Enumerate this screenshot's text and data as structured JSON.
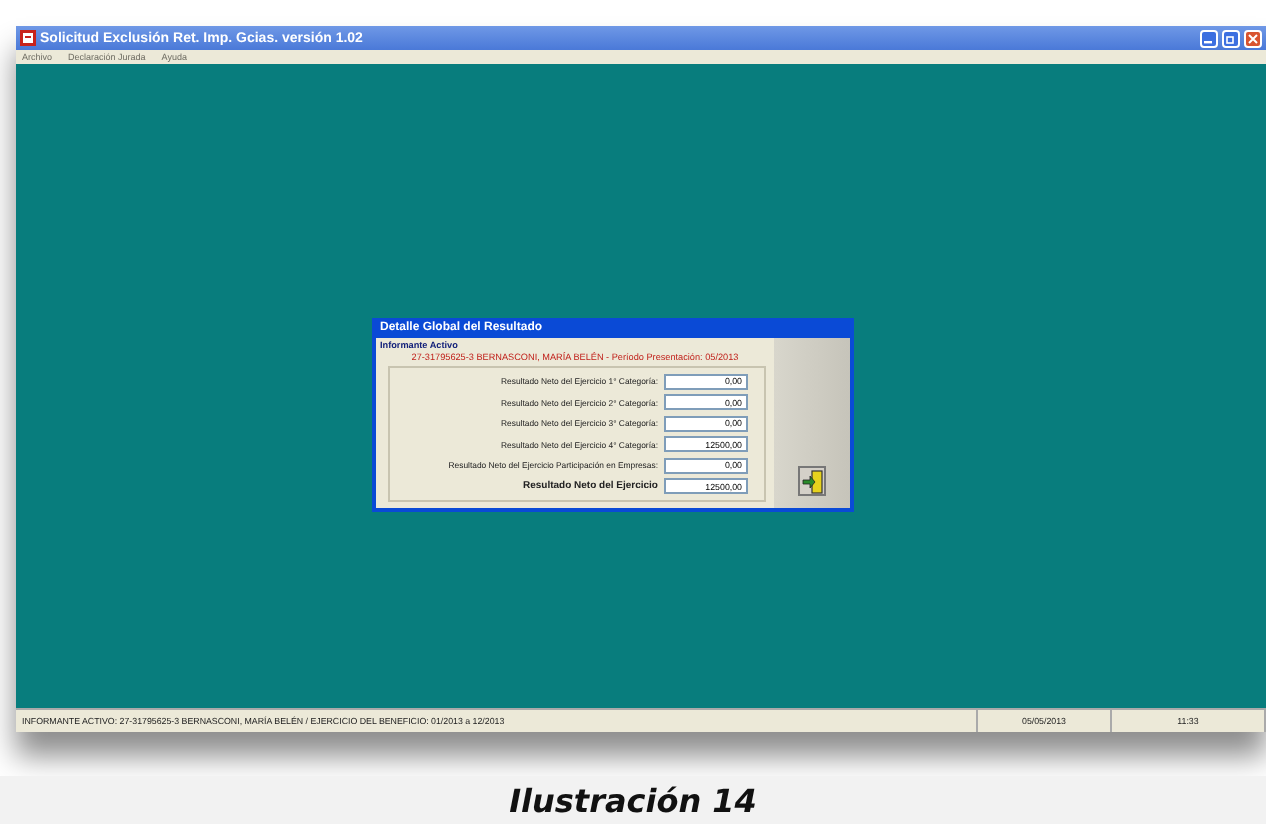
{
  "window": {
    "title": "Solicitud Exclusión Ret. Imp. Gcias. versión 1.02"
  },
  "menu": [
    "Archivo",
    "Declaración Jurada",
    "Ayuda"
  ],
  "dialog": {
    "title": "Detalle Global del Resultado",
    "section": "Informante Activo",
    "informant": "27-31795625-3 BERNASCONI, MARÍA BELÉN  - Período Presentación: 05/2013",
    "rows": [
      {
        "label": "Resultado Neto del Ejercicio 1° Categoría:",
        "value": "0,00",
        "kind": "normal"
      },
      {
        "label": "Resultado Neto del Ejercicio 2° Categoría:",
        "value": "0,00",
        "kind": "normal"
      },
      {
        "label": "Resultado Neto del Ejercicio 3° Categoría:",
        "value": "0,00",
        "kind": "normal"
      },
      {
        "label": "Resultado Neto del Ejercicio 4° Categoría:",
        "value": "12500,00",
        "kind": "normal"
      },
      {
        "label": "Resultado Neto del Ejercicio Participación en Empresas:",
        "value": "0,00",
        "kind": "normal"
      },
      {
        "label": "Resultado Neto del Ejercicio",
        "value": "12500,00",
        "kind": "total"
      }
    ]
  },
  "status_bar": {
    "info": "INFORMANTE ACTIVO: 27-31795625-3 BERNASCONI, MARÍA BELÉN  / EJERCICIO DEL BENEFICIO: 01/2013 a 12/2013",
    "date": "05/05/2013",
    "time": "11:33"
  },
  "caption": "Ilustración 14"
}
